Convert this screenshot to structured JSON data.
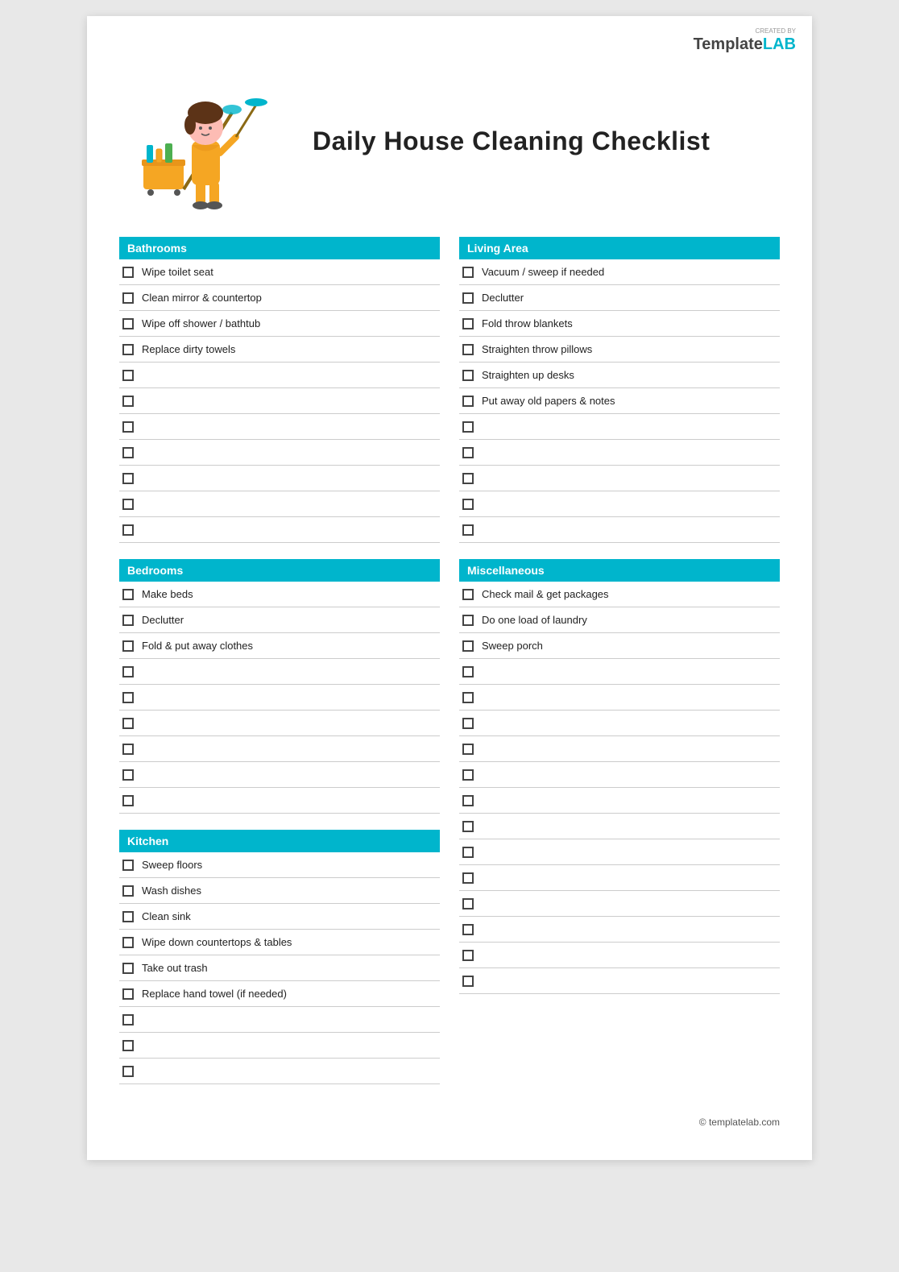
{
  "logo": {
    "created_by": "CREATED BY",
    "template_part": "Template",
    "lab_part": "LAB"
  },
  "title": "Daily House Cleaning Checklist",
  "sections": {
    "left": [
      {
        "name": "Bathrooms",
        "items": [
          "Wipe toilet seat",
          "Clean mirror & countertop",
          "Wipe off shower / bathtub",
          "Replace dirty towels",
          "",
          "",
          "",
          "",
          "",
          "",
          ""
        ]
      },
      {
        "name": "Bedrooms",
        "items": [
          "Make beds",
          "Declutter",
          "Fold & put away clothes",
          "",
          "",
          "",
          "",
          "",
          ""
        ]
      },
      {
        "name": "Kitchen",
        "items": [
          "Sweep floors",
          "Wash dishes",
          "Clean sink",
          "Wipe down countertops & tables",
          "Take out trash",
          "Replace hand towel (if needed)",
          "",
          "",
          ""
        ]
      }
    ],
    "right": [
      {
        "name": "Living Area",
        "items": [
          "Vacuum / sweep if needed",
          "Declutter",
          "Fold throw blankets",
          "Straighten throw pillows",
          "Straighten up desks",
          "Put away old papers & notes",
          "",
          "",
          "",
          "",
          ""
        ]
      },
      {
        "name": "Miscellaneous",
        "items": [
          "Check mail & get packages",
          "Do one load of laundry",
          "Sweep porch",
          "",
          "",
          "",
          "",
          "",
          "",
          "",
          "",
          "",
          "",
          "",
          "",
          ""
        ]
      }
    ]
  },
  "footer": "© templatelab.com"
}
